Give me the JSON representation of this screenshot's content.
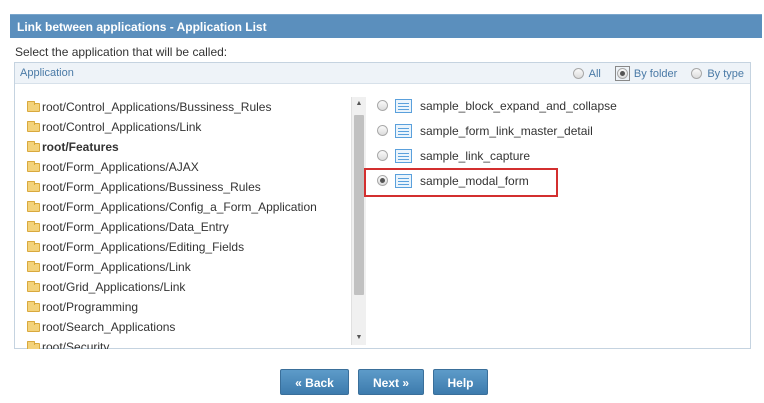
{
  "title": "Link between applications - Application List",
  "instruction": "Select the application that will be called:",
  "panel": {
    "header_label": "Application",
    "view_options": [
      {
        "label": "All",
        "checked": false
      },
      {
        "label": "By folder",
        "checked": true
      },
      {
        "label": "By type",
        "checked": false
      }
    ]
  },
  "folders": [
    {
      "label": "root/Control_Applications/Bussiness_Rules",
      "bold": false
    },
    {
      "label": "root/Control_Applications/Link",
      "bold": false
    },
    {
      "label": "root/Features",
      "bold": true
    },
    {
      "label": "root/Form_Applications/AJAX",
      "bold": false
    },
    {
      "label": "root/Form_Applications/Bussiness_Rules",
      "bold": false
    },
    {
      "label": "root/Form_Applications/Config_a_Form_Application",
      "bold": false
    },
    {
      "label": "root/Form_Applications/Data_Entry",
      "bold": false
    },
    {
      "label": "root/Form_Applications/Editing_Fields",
      "bold": false
    },
    {
      "label": "root/Form_Applications/Link",
      "bold": false
    },
    {
      "label": "root/Grid_Applications/Link",
      "bold": false
    },
    {
      "label": "root/Programming",
      "bold": false
    },
    {
      "label": "root/Search_Applications",
      "bold": false
    },
    {
      "label": "root/Security",
      "bold": false
    }
  ],
  "applications": [
    {
      "label": "sample_block_expand_and_collapse",
      "checked": false
    },
    {
      "label": "sample_form_link_master_detail",
      "checked": false
    },
    {
      "label": "sample_link_capture",
      "checked": false
    },
    {
      "label": "sample_modal_form",
      "checked": true
    }
  ],
  "buttons": {
    "back": "« Back",
    "next": "Next »",
    "help": "Help"
  },
  "scroll_up_glyph": "▲",
  "scroll_down_glyph": "▼"
}
